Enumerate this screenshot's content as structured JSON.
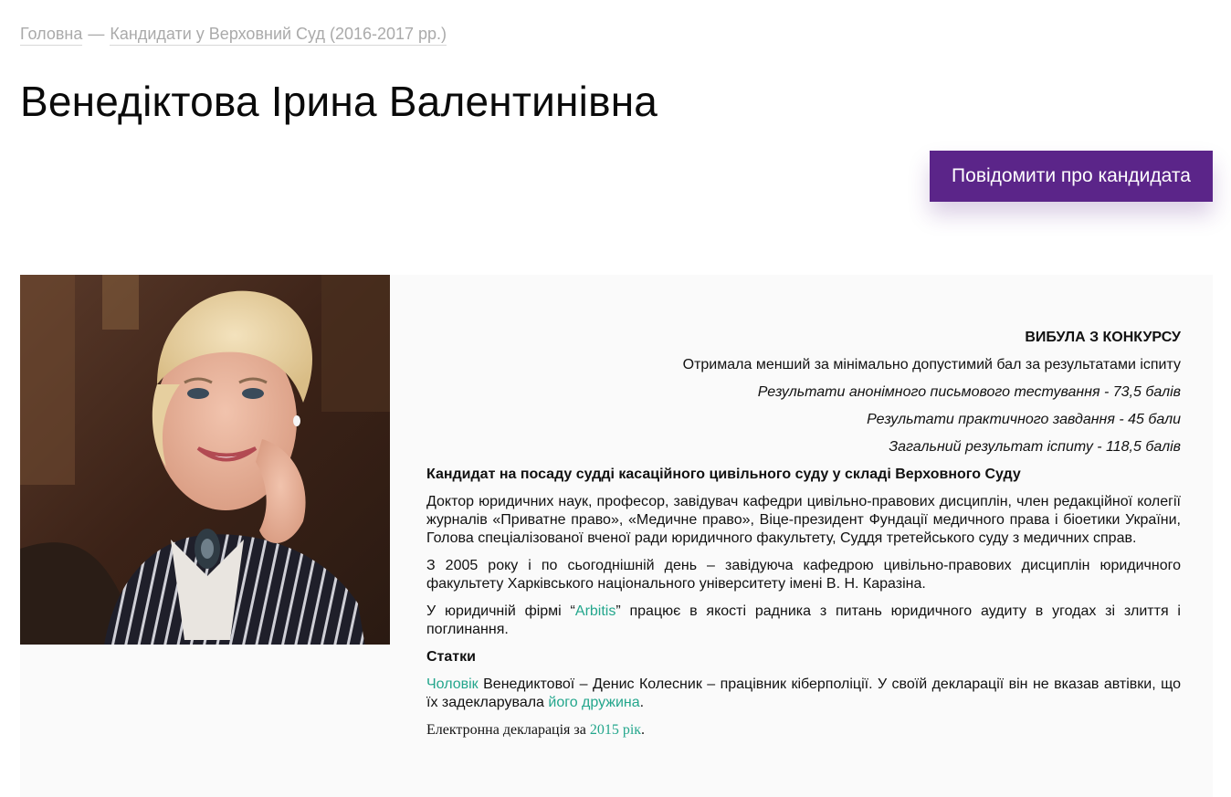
{
  "breadcrumb": {
    "home": "Головна",
    "separator": "—",
    "section": "Кандидати у Верховний Суд (2016-2017 рр.)"
  },
  "title": "Венедіктова Ірина Валентинівна",
  "report_button": "Повідомити про кандидата",
  "colors": {
    "accent": "#5b2589",
    "link": "#23a68c",
    "card_bg": "#fafafa"
  },
  "status": {
    "heading": "ВИБУЛА З КОНКУРСУ",
    "reason": "Отримала менший за мінімально  допустимий бал за результатами іспиту",
    "test_result": "Результати анонімного письмового тестування -  73,5 балів",
    "practical_result": "Результати практичного завдання - 45 бали",
    "total_result": "Загальний результат іспиту - 118,5 балів"
  },
  "candidate_heading": "Кандидат на посаду судді касаційного цивільного суду у складі Верховного Суду",
  "bio_1": "Доктор юридичних наук, професор, завідувач кафедри цивільно-правових дисциплін, член редакційної колегії журналів «Приватне право», «Медичне право», Віце-президент Фундації медичного права і біоетики України, Голова спеціалізованої вченої ради юридичного факультету, Суддя третейського суду з медичних справ.",
  "bio_2": "З 2005 року і по сьогоднішній день – завідуюча кафедрою цивільно-правових дисциплін юридичного факультету Харківського національного університету імені В. Н. Каразіна.",
  "bio_3": {
    "before": "У юридичній фірмі “",
    "link": "Arbitis",
    "after": "” працює в якості радника з питань юридичного аудиту в угодах зі злиття і поглинання."
  },
  "articles_heading": "Статки",
  "articles": {
    "link1": "Чоловік",
    "text1": " Венедиктової – Денис Колесник – працівник кіберполіції. У своїй декларації він не вказав автівки, що їх задекларувала ",
    "link2": "його дружина",
    "text2": "."
  },
  "declaration": {
    "before": "Електронна декларація за ",
    "link": "2015 рік",
    "after": "."
  },
  "photo_icon": "candidate-photo"
}
